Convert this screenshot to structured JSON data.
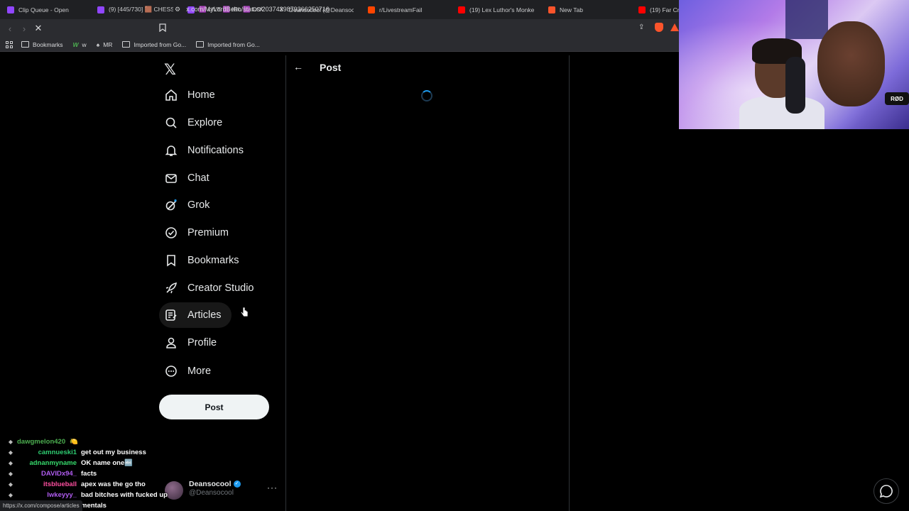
{
  "browser": {
    "tabs": [
      {
        "title": "Clip Queue - Open",
        "icon": "twitch-icon",
        "color": "#9146ff"
      },
      {
        "title": "(9) [445/730] 🟫 CHESS ·",
        "icon": "twitch-icon",
        "color": "#9146ff"
      },
      {
        "title": "🟪 LIVE 🟪 IRL 🟪 COOKING",
        "icon": "twitch-icon",
        "color": "#9146ff"
      },
      {
        "title": "Deansocool (@Deansoco",
        "icon": "x-icon",
        "color": "#000000"
      },
      {
        "title": "r/LivestreamFail",
        "icon": "reddit-icon",
        "color": "#ff4500"
      },
      {
        "title": "(19) Lex Luthor's Monkey",
        "icon": "youtube-icon",
        "color": "#ff0000"
      },
      {
        "title": "New Tab",
        "icon": "brave-icon",
        "color": "#fb542b"
      },
      {
        "title": "(19) Far Cry",
        "icon": "youtube-icon",
        "color": "#ff0000"
      }
    ],
    "url": "x.com/MyLordBebo/status/2037439879366250716",
    "bookmarks": [
      {
        "label": "Bookmarks",
        "icon": "bookmarks-icon"
      },
      {
        "label": "w",
        "icon": "w-icon"
      },
      {
        "label": "MR",
        "icon": "mr-icon"
      },
      {
        "label": "Imported from Go...",
        "icon": "folder-icon"
      },
      {
        "label": "Imported from Go...",
        "icon": "folder-icon"
      }
    ],
    "status_url": "https://x.com/compose/articles"
  },
  "nav": {
    "items": [
      {
        "label": "Home",
        "icon": "home-icon"
      },
      {
        "label": "Explore",
        "icon": "search-icon"
      },
      {
        "label": "Notifications",
        "icon": "bell-icon"
      },
      {
        "label": "Chat",
        "icon": "mail-icon"
      },
      {
        "label": "Grok",
        "icon": "grok-icon"
      },
      {
        "label": "Premium",
        "icon": "premium-icon"
      },
      {
        "label": "Bookmarks",
        "icon": "bookmark-icon"
      },
      {
        "label": "Creator Studio",
        "icon": "rocket-icon"
      },
      {
        "label": "Articles",
        "icon": "article-icon"
      },
      {
        "label": "Profile",
        "icon": "person-icon"
      },
      {
        "label": "More",
        "icon": "more-circle-icon"
      }
    ],
    "post_label": "Post"
  },
  "main": {
    "title": "Post"
  },
  "account": {
    "name": "Deansocool",
    "handle": "@Deansocool",
    "more": "···"
  },
  "chat": [
    {
      "user": "dawgmelon420",
      "msg": "🍋",
      "color": "#4caf50"
    },
    {
      "user": "camnueski1",
      "msg": "get out my business",
      "color": "#2ecc71"
    },
    {
      "user": "adnanmyname",
      "msg": "OK name one🔤",
      "color": "#36d96b"
    },
    {
      "user": "DAVIDx94_",
      "msg": "facts",
      "color": "#b05cf0"
    },
    {
      "user": "itsblueball",
      "msg": "apex was the go tho",
      "color": "#ff4fa0"
    },
    {
      "user": "lwkeyyy_",
      "msg": "bad bitches with fucked up",
      "color": "#b05cf0"
    },
    {
      "user": "",
      "msg": "mentals",
      "color": "#ffffff"
    }
  ],
  "webcam": {
    "label": "RØD"
  },
  "colors": {
    "accent": "#1d9bf0",
    "background": "#000000",
    "border": "#2f3336"
  }
}
